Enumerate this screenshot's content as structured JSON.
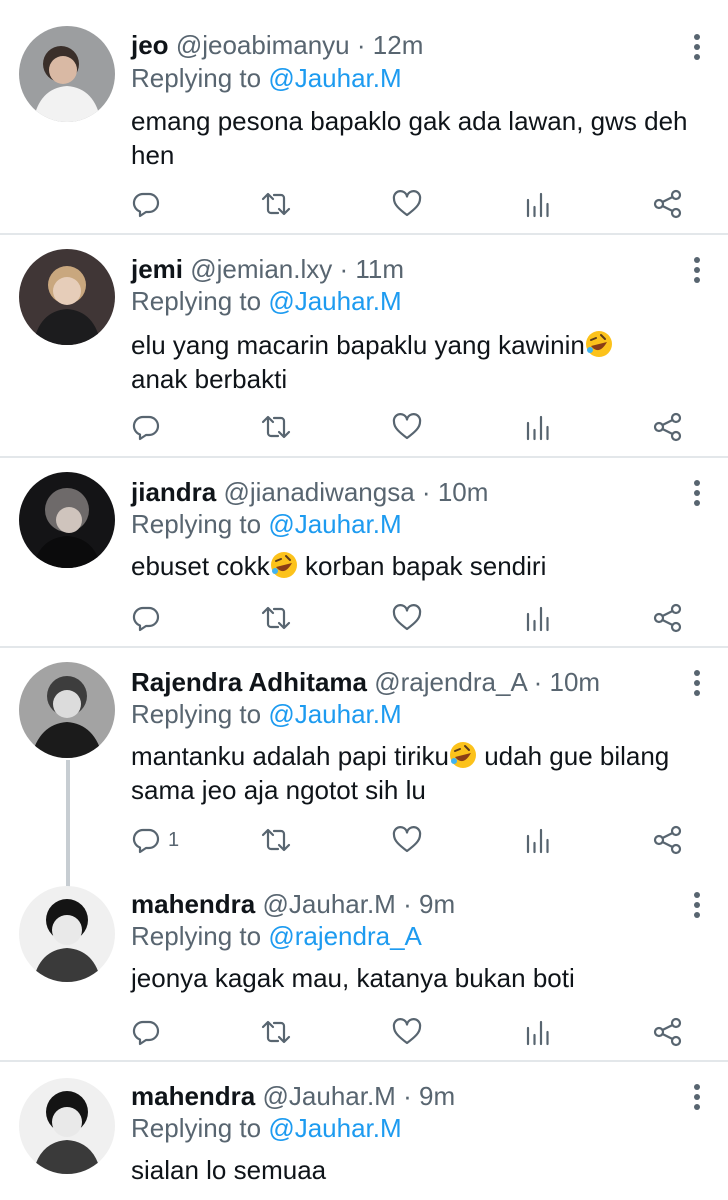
{
  "tweets": [
    {
      "name": "jeo",
      "handle": "@jeoabimanyu",
      "sep": "·",
      "time": "12m",
      "replying_label": "Replying to",
      "replying_to": "@Jauhar.M",
      "text": "emang pesona bapaklo gak ada lawan, gws deh hen",
      "emoji": "",
      "text_after": "",
      "reply_count": "",
      "avatar_bg": "#8a8c8e"
    },
    {
      "name": "jemi",
      "handle": "@jemian.lxy",
      "sep": "·",
      "time": "11m",
      "replying_label": "Replying to",
      "replying_to": "@Jauhar.M",
      "text": "elu yang macarin bapaklu yang kawinin",
      "emoji": "rolling-on-floor-laughing-emoji",
      "text_after": "anak berbakti",
      "reply_count": "",
      "avatar_bg": "#4a3f3f"
    },
    {
      "name": "jiandra",
      "handle": "@jianadiwangsa",
      "sep": "·",
      "time": "10m",
      "replying_label": "Replying to",
      "replying_to": "@Jauhar.M",
      "text": "ebuset cokk",
      "emoji": "rolling-on-floor-laughing-emoji",
      "text_after": " korban bapak sendiri",
      "reply_count": "",
      "avatar_bg": "#2b2b2f"
    },
    {
      "name": "Rajendra Adhitama",
      "handle": "@rajendra_A",
      "sep": "·",
      "time": "10m",
      "replying_label": "Replying to",
      "replying_to": "@Jauhar.M",
      "text": "mantanku adalah papi tiriku",
      "emoji": "rolling-on-floor-laughing-emoji",
      "text_after": " udah gue bilang sama jeo aja ngotot sih lu",
      "reply_count": "1",
      "avatar_bg": "#9a9a9a"
    },
    {
      "name": "mahendra",
      "handle": "@Jauhar.M",
      "sep": "·",
      "time": "9m",
      "replying_label": "Replying to",
      "replying_to": "@rajendra_A",
      "text": "jeonya kagak mau, katanya bukan boti",
      "emoji": "",
      "text_after": "",
      "reply_count": "",
      "avatar_bg": "#e6e6e6"
    },
    {
      "name": "mahendra",
      "handle": "@Jauhar.M",
      "sep": "·",
      "time": "9m",
      "replying_label": "Replying to",
      "replying_to": "@Jauhar.M",
      "text": "sialan lo semuaa",
      "emoji": "",
      "text_after": "",
      "reply_count": "",
      "avatar_bg": "#e6e6e6"
    }
  ],
  "colors": {
    "link": "#1d9bf0",
    "muted": "#586570",
    "divider": "#e3e7ea"
  }
}
